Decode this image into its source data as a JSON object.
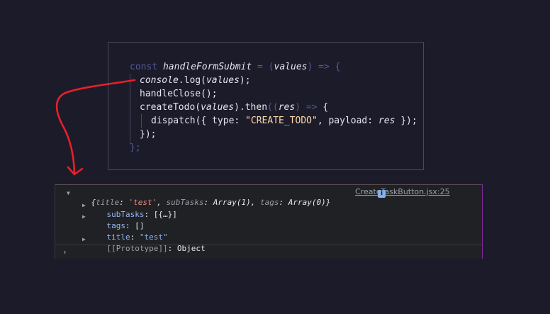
{
  "code": {
    "line1": {
      "kw": "const",
      "name": "handleFormSubmit",
      "eq": "=",
      "open": "(",
      "param": "values",
      "close": ")",
      "arrow": "=>",
      "brace": "{"
    },
    "line2": {
      "obj": "console",
      "dot": ".",
      "method": "log",
      "open": "(",
      "arg": "values",
      "close": ");"
    },
    "line3": {
      "text": "handleClose();"
    },
    "line4": {
      "fn": "createTodo",
      "open": "(",
      "arg": "values",
      "close": ")",
      "then": ".then",
      "p2": "((",
      "res": "res",
      "p3": ")",
      "arrow": "=>",
      "brace": "{"
    },
    "line5": {
      "pre": "dispatch({ ",
      "typeKey": "type",
      "colon1": ": ",
      "typeVal": "\"CREATE_TODO\"",
      "comma": ", ",
      "payloadKey": "payload",
      "colon2": ": ",
      "payloadVal": "res",
      "post": " });"
    },
    "line6": {
      "text": "});"
    },
    "line7": {
      "text": "};"
    }
  },
  "console": {
    "summary": {
      "open": "{",
      "k1": "title",
      "v1": "'test'",
      "k2": "subTasks",
      "v2": "Array(1)",
      "k3": "tags",
      "v3": "Array(0)",
      "close": "}"
    },
    "info_badge": "i",
    "source_link": "CreateTaskButton.jsx:25",
    "rows": [
      {
        "key": "subTasks",
        "value": "[{…}]"
      },
      {
        "key": "tags",
        "value": "[]"
      },
      {
        "key": "title",
        "value": "\"test\""
      },
      {
        "key": "[[Prototype]]",
        "value": "Object"
      }
    ],
    "prompt": "›"
  },
  "colors": {
    "arrow": "#e8202a",
    "background": "#1c1b29",
    "console_bg": "#202124"
  }
}
